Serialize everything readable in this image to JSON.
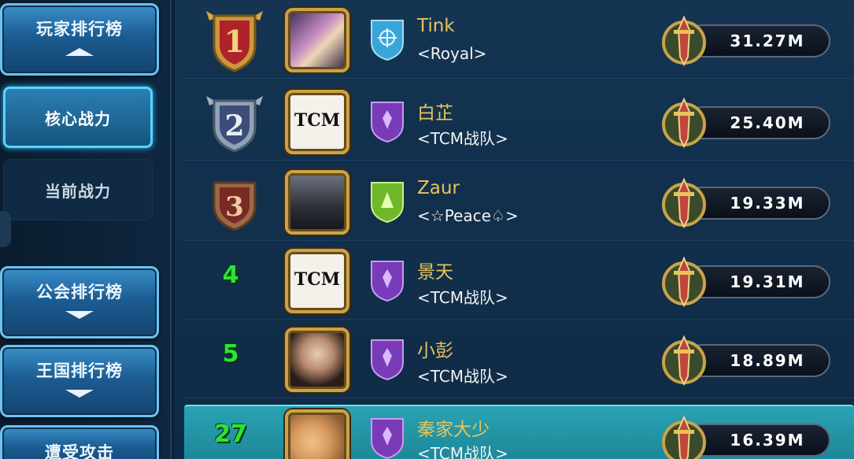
{
  "sidebar": {
    "player_ranking": "玩家排行榜",
    "core_power": "核心战力",
    "current_power": "当前战力",
    "guild_ranking": "公会排行榜",
    "kingdom_ranking": "王国排行榜",
    "attacked": "遭受攻击"
  },
  "rows": [
    {
      "rank": "1",
      "name": "Tink",
      "guild": "<Royal>",
      "power": "31.27M",
      "badge": "gold-rank-badge",
      "shield": "blue"
    },
    {
      "rank": "2",
      "name": "白芷",
      "guild": "<TCM战队>",
      "power": "25.40M",
      "badge": "silver-rank-badge",
      "shield": "purple"
    },
    {
      "rank": "3",
      "name": "Zaur",
      "guild": "<☆Peace♤>",
      "power": "19.33M",
      "badge": "bronze-rank-badge",
      "shield": "green"
    },
    {
      "rank": "4",
      "name": "景天",
      "guild": "<TCM战队>",
      "power": "19.31M",
      "shield": "purple"
    },
    {
      "rank": "5",
      "name": "小彭",
      "guild": "<TCM战队>",
      "power": "18.89M",
      "shield": "purple"
    },
    {
      "rank": "27",
      "name": "秦家大少",
      "guild": "<TCM战队>",
      "power": "16.39M",
      "shield": "purple",
      "self": true
    }
  ],
  "avatar_tcm_text": "TCM",
  "colors": {
    "name": "#e8c45a",
    "rank_green": "#2de23a",
    "highlight_row": "#2aa3b3"
  }
}
